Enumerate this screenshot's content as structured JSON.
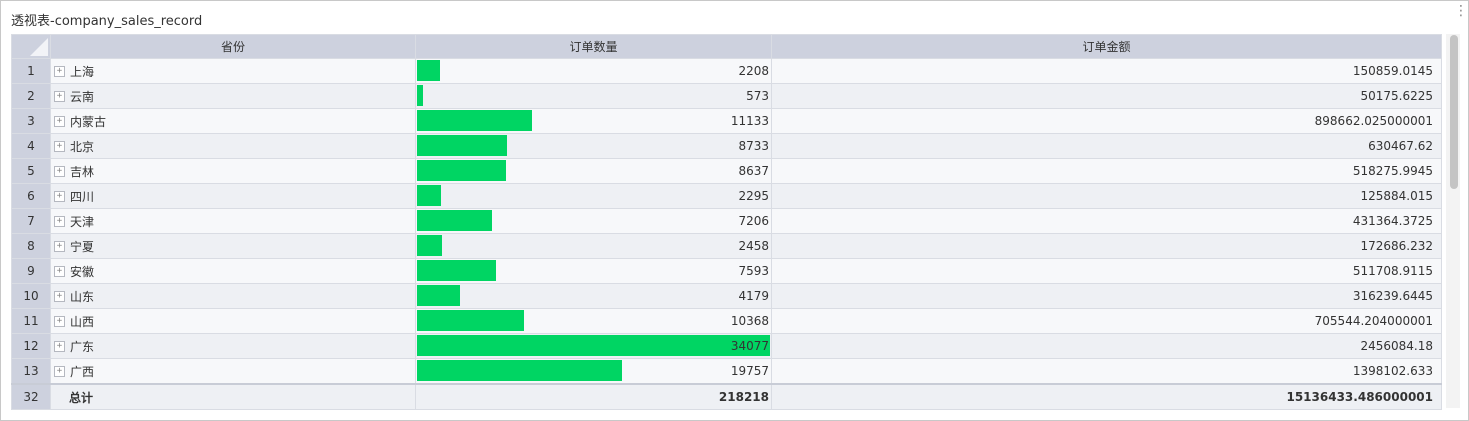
{
  "panel": {
    "title": "透视表-company_sales_record"
  },
  "columns": [
    "省份",
    "订单数量",
    "订单金额"
  ],
  "qty_max": 34077,
  "rows": [
    {
      "n": "1",
      "province": "上海",
      "qty": 2208,
      "qty_text": "2208",
      "amount": "150859.0145"
    },
    {
      "n": "2",
      "province": "云南",
      "qty": 573,
      "qty_text": "573",
      "amount": "50175.6225"
    },
    {
      "n": "3",
      "province": "内蒙古",
      "qty": 11133,
      "qty_text": "11133",
      "amount": "898662.025000001"
    },
    {
      "n": "4",
      "province": "北京",
      "qty": 8733,
      "qty_text": "8733",
      "amount": "630467.62"
    },
    {
      "n": "5",
      "province": "吉林",
      "qty": 8637,
      "qty_text": "8637",
      "amount": "518275.9945"
    },
    {
      "n": "6",
      "province": "四川",
      "qty": 2295,
      "qty_text": "2295",
      "amount": "125884.015"
    },
    {
      "n": "7",
      "province": "天津",
      "qty": 7206,
      "qty_text": "7206",
      "amount": "431364.3725"
    },
    {
      "n": "8",
      "province": "宁夏",
      "qty": 2458,
      "qty_text": "2458",
      "amount": "172686.232"
    },
    {
      "n": "9",
      "province": "安徽",
      "qty": 7593,
      "qty_text": "7593",
      "amount": "511708.9115"
    },
    {
      "n": "10",
      "province": "山东",
      "qty": 4179,
      "qty_text": "4179",
      "amount": "316239.6445"
    },
    {
      "n": "11",
      "province": "山西",
      "qty": 10368,
      "qty_text": "10368",
      "amount": "705544.204000001"
    },
    {
      "n": "12",
      "province": "广东",
      "qty": 34077,
      "qty_text": "34077",
      "amount": "2456084.18"
    },
    {
      "n": "13",
      "province": "广西",
      "qty": 19757,
      "qty_text": "19757",
      "amount": "1398102.633"
    }
  ],
  "total": {
    "n": "32",
    "label": "总计",
    "qty": "218218",
    "amount": "15136433.486000001"
  },
  "colors": {
    "bar": "#00d563",
    "header": "#cdd1de"
  },
  "icons": {
    "expand": "plus-square-icon",
    "more": "more-vertical-icon"
  }
}
